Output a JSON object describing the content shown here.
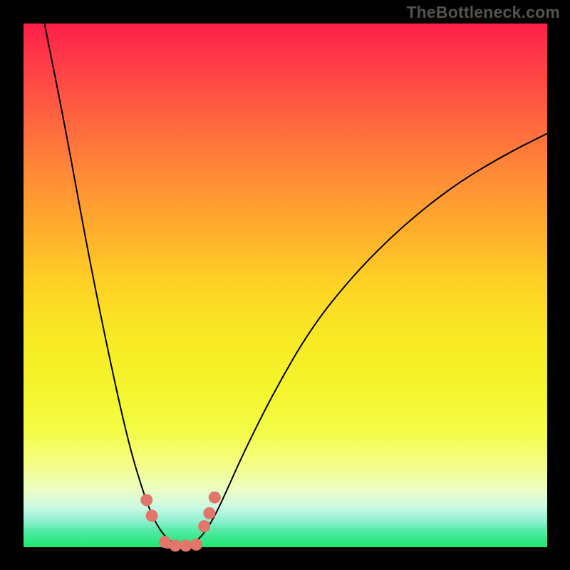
{
  "watermark": "TheBottleneck.com",
  "colors": {
    "background": "#000000",
    "dot": "#e2766a",
    "gradient_top": "#fe1f49",
    "gradient_bottom": "#22e670"
  },
  "chart_data": {
    "type": "line",
    "title": "",
    "xlabel": "",
    "ylabel": "",
    "xlim": [
      0,
      100
    ],
    "ylim": [
      0,
      100
    ],
    "grid": false,
    "legend": false,
    "series": [
      {
        "name": "bottleneck-curve",
        "x": [
          4,
          8,
          12,
          16,
          20,
          23,
          25,
          27,
          29,
          30.5,
          32,
          34,
          36,
          38,
          42,
          48,
          55,
          63,
          72,
          82,
          92,
          100
        ],
        "y": [
          100,
          80,
          58,
          38,
          20,
          10,
          5,
          2,
          0.5,
          0,
          0.5,
          2,
          5,
          9,
          18,
          30,
          42,
          52,
          61,
          69,
          75,
          79
        ]
      }
    ],
    "markers": [
      {
        "x": 23.5,
        "y": 9
      },
      {
        "x": 24.5,
        "y": 6
      },
      {
        "x": 27.0,
        "y": 1
      },
      {
        "x": 29.0,
        "y": 0.3
      },
      {
        "x": 31.0,
        "y": 0.3
      },
      {
        "x": 33.0,
        "y": 0.5
      },
      {
        "x": 34.5,
        "y": 4
      },
      {
        "x": 35.5,
        "y": 6.5
      },
      {
        "x": 36.5,
        "y": 9.5
      }
    ],
    "flat_segment": {
      "x_start": 27,
      "x_end": 33,
      "y": 0.3
    }
  }
}
